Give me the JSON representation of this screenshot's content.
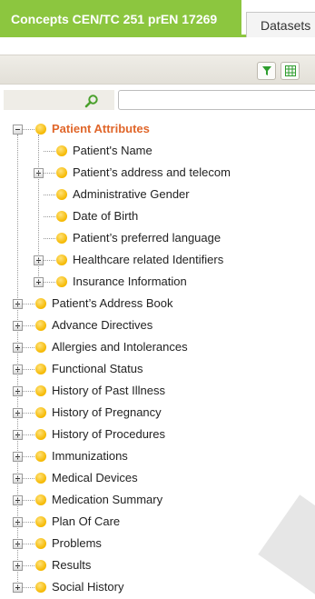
{
  "tabs": {
    "active_label": "Concepts CEN/TC 251 prEN 17269",
    "second_label": "Datasets"
  },
  "search": {
    "value": "",
    "placeholder": ""
  },
  "tree": {
    "root": {
      "label": "Patient Attributes"
    },
    "children": [
      {
        "label": "Patient's Name",
        "expandable": false
      },
      {
        "label": "Patient’s address and telecom",
        "expandable": true
      },
      {
        "label": "Administrative Gender",
        "expandable": false
      },
      {
        "label": "Date of Birth",
        "expandable": false
      },
      {
        "label": "Patient’s preferred language",
        "expandable": false
      },
      {
        "label": "Healthcare related Identifiers",
        "expandable": true
      },
      {
        "label": "Insurance Information",
        "expandable": true
      }
    ],
    "top_level": [
      {
        "label": "Patient’s Address Book"
      },
      {
        "label": "Advance Directives"
      },
      {
        "label": "Allergies and Intolerances"
      },
      {
        "label": "Functional Status"
      },
      {
        "label": "History of Past Illness"
      },
      {
        "label": "History of Pregnancy"
      },
      {
        "label": "History of Procedures"
      },
      {
        "label": "Immunizations"
      },
      {
        "label": "Medical Devices"
      },
      {
        "label": "Medication Summary"
      },
      {
        "label": "Plan Of Care"
      },
      {
        "label": "Problems"
      },
      {
        "label": "Results"
      },
      {
        "label": "Social History"
      }
    ]
  },
  "colors": {
    "accent": "#8cc63f",
    "root_text": "#e0662a",
    "bullet": "#f5b800",
    "toolbar_filter_icon": "#2e9e2e",
    "toolbar_grid_icon": "#2e9e2e"
  },
  "icons": [
    "filter-icon",
    "grid-icon",
    "search-icon",
    "bullet-icon",
    "expand-icon",
    "collapse-icon"
  ]
}
